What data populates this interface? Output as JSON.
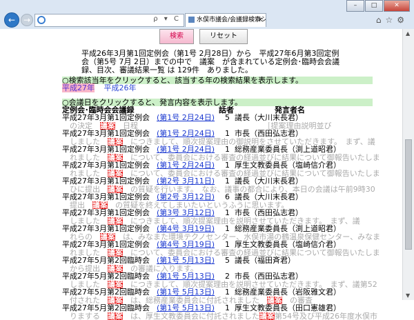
{
  "browser": {
    "address_text": "",
    "tab_title": "水俣市議会/会議録検索シ...",
    "address_controls": "ρ ▾ C"
  },
  "buttons": {
    "search": "検索",
    "reset": "リセット"
  },
  "summary": "平成26年3月第1回定例会（第1号 2月28日）から　平成27年6月第3回定例会（第5号 7月 2日）までの中で　議案　が含まれている定例会･臨時会会議録、目次、審議結果一覧 は 129件　ありました。",
  "instruction_years": "○検索該当年をクリックすると、該当する年の検索結果を表示します。",
  "years": [
    "平成27年",
    "平成26年"
  ],
  "instruction_dates": "○会議日をクリックすると、発言内容を表示します。",
  "headers": {
    "meeting": "定例会･臨時会会議録",
    "no": "話者",
    "speaker": "発言者名"
  },
  "entries": [
    {
      "meeting": "平成27年3月第1回定例会",
      "date": "(第1号 2月24日)",
      "no": "5",
      "speaker": "議長（大川末長君）",
      "snippet": "　の決定　議案　日程　　　　　　　　　　　　　　　　　［提案理由説明並び"
    },
    {
      "meeting": "平成27年3月第1回定例会",
      "date": "(第1号 2月24日)",
      "no": "1",
      "speaker": "市長（西田弘志君）",
      "snippet": "　しました　議案　につきまして、順次提案理由の御説明をさせていただきます。　まず、議"
    },
    {
      "meeting": "平成27年3月第1回定例会",
      "date": "(第1号 2月24日)",
      "no": "1",
      "speaker": "総務産業委員長（渕上道昭君）",
      "snippet": "　れました　議案　について、委員会における審査の経過並びに結果について御報告いたします。"
    },
    {
      "meeting": "平成27年3月第1回定例会",
      "date": "(第1号 2月24日)",
      "no": "1",
      "speaker": "厚生文教委員長（塩崎信介君）",
      "snippet": "　れました　議案　について、委員会における審査の経過並びに結果について御報告いたします。"
    },
    {
      "meeting": "平成27年3月第1回定例会",
      "date": "(第2号 3月11日)",
      "no": "1",
      "speaker": "議長（大川末長君）",
      "snippet": "　ひに提出　議案　の質疑を行います。　なお、議事の都合により、本日の会議は午前9時30"
    },
    {
      "meeting": "平成27年3月第1回定例会",
      "date": "(第2号 3月12日)",
      "no": "6",
      "speaker": "議長（大川末長君）",
      "snippet": "　提出　議案　の質疑を終えてしまいたいというふうに思います。"
    },
    {
      "meeting": "平成27年3月第1回定例会",
      "date": "(第3号 3月12日)",
      "no": "1",
      "speaker": "市長（西田弘志君）",
      "snippet": "　しました　議案　につきまして、順次提案理由を説明させていただきます。　まず、議"
    },
    {
      "meeting": "平成27年3月第1回定例会",
      "date": "(第4号 3月19日)",
      "no": "1",
      "speaker": "総務産業委員長（渕上道昭君）",
      "snippet": "　れらの　議案　は、みなまた環境テクノセンター、水俣市湯の鶴温泉保健センター、みなまた"
    },
    {
      "meeting": "平成27年3月第1回定例会",
      "date": "(第4号 3月19日)",
      "no": "1",
      "speaker": "厚生文教委員長（塩崎信介君）",
      "snippet": "　れました　議案　について、委員会における審査の経過並びに結果について御報告いたします。"
    },
    {
      "meeting": "平成27年5月第2回臨時会",
      "date": "(第1号 5月13日)",
      "no": "5",
      "speaker": "議長（福田斉君）",
      "snippet": "　から提出　議案　の審議に入ります。"
    },
    {
      "meeting": "平成27年5月第2回臨時会",
      "date": "(第1号 5月13日)",
      "no": "2",
      "speaker": "市長（西田弘志君）",
      "snippet": "　しました　議案　につきまして、順次提案理由を説明させていただきます。　まず、議第52"
    },
    {
      "meeting": "平成27年5月第2回臨時会",
      "date": "(第1号 5月13日)",
      "no": "1",
      "speaker": "総務産業委員長（岩阪雅文君）",
      "snippet": "　付された　議案　は、総務産業委員会に付託されました　議案　の審査"
    },
    {
      "meeting": "平成27年5月第2回臨時会",
      "date": "(第1号 5月13日)",
      "no": "1",
      "speaker": "厚生文教委員長（田口憲雄君）",
      "snippet": "　りまする　議案　は、厚生文教委員会に付託されました議案第54号及び平成26年度水俣市"
    }
  ],
  "colors": {
    "accent": "#2f4ad6",
    "keyword": "#e60000",
    "instruction_bg": "#ccf0c8"
  }
}
